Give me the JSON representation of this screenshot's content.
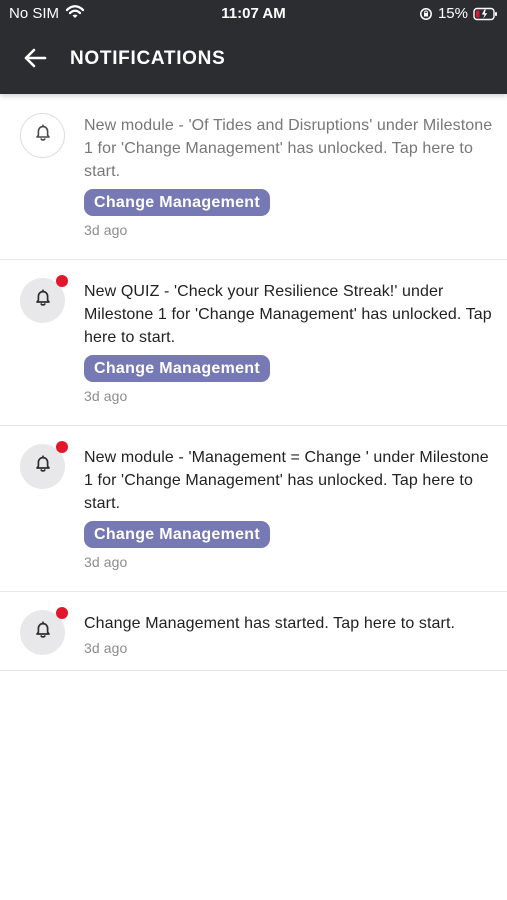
{
  "status_bar": {
    "carrier": "No SIM",
    "time": "11:07 AM",
    "battery": "15%"
  },
  "header": {
    "title": "NOTIFICATIONS"
  },
  "notifications": [
    {
      "text": "New module - 'Of Tides and Disruptions' under Milestone 1 for 'Change Management' has unlocked. Tap here to start.",
      "tag": "Change Management",
      "time": "3d ago"
    },
    {
      "text": "New QUIZ - 'Check your Resilience Streak!' under Milestone 1 for 'Change Management' has unlocked. Tap here to start.",
      "tag": "Change Management",
      "time": "3d ago"
    },
    {
      "text": "New module - 'Management = Change ' under Milestone 1 for 'Change Management' has unlocked. Tap here to start.",
      "tag": "Change Management",
      "time": "3d ago"
    },
    {
      "text": "Change Management has started. Tap here to start.",
      "time": "3d ago"
    }
  ],
  "colors": {
    "header_background": "#2b2d30",
    "chip_background": "#7679b3",
    "unread_dot": "#e1182b"
  },
  "icons": {
    "back": "back-arrow-icon",
    "notification": "bell-icon",
    "wifi": "wifi-icon",
    "battery": "battery-charging-icon"
  }
}
